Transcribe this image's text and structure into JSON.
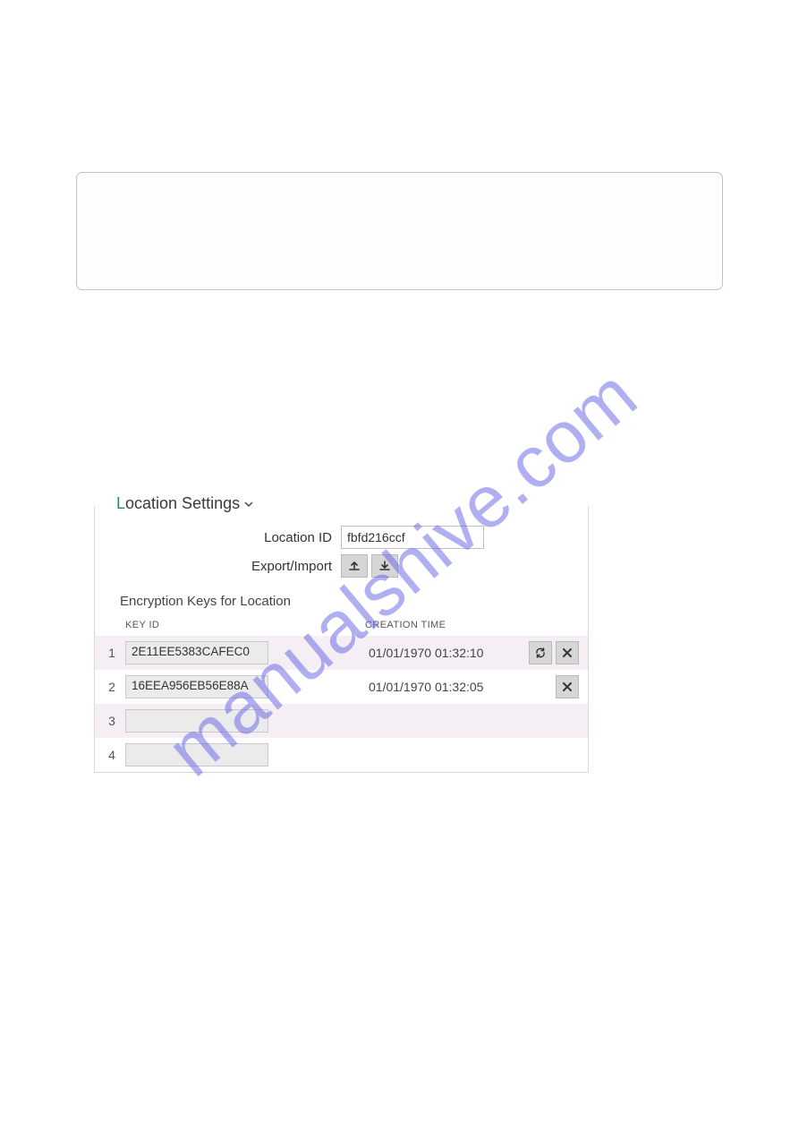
{
  "watermark": "manualshive.com",
  "panel": {
    "title_first": "L",
    "title_rest": "ocation Settings",
    "location_id_label": "Location ID",
    "location_id_value": "fbfd216ccf",
    "export_import_label": "Export/Import",
    "encryption_section_title": "Encryption Keys for Location",
    "headers": {
      "key_id": "KEY ID",
      "creation_time": "CREATION TIME"
    },
    "rows": [
      {
        "idx": "1",
        "key": "2E11EE5383CAFEC0",
        "time": "01/01/1970 01:32:10",
        "has_refresh": true,
        "has_delete": true
      },
      {
        "idx": "2",
        "key": "16EEA956EB56E88A",
        "time": "01/01/1970 01:32:05",
        "has_refresh": false,
        "has_delete": true
      },
      {
        "idx": "3",
        "key": "",
        "time": "",
        "has_refresh": false,
        "has_delete": false
      },
      {
        "idx": "4",
        "key": "",
        "time": "",
        "has_refresh": false,
        "has_delete": false
      }
    ]
  }
}
